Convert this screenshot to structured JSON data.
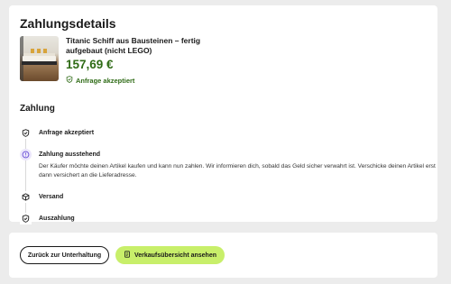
{
  "header": {
    "title": "Zahlungsdetails"
  },
  "product": {
    "title": "Titanic Schiff aus Bausteinen – fertig aufgebaut (nicht LEGO)",
    "price": "157,69 €",
    "status": "Anfrage akzeptiert",
    "status_color": "#2f6b16"
  },
  "payment": {
    "section_title": "Zahlung",
    "steps": [
      {
        "label": "Anfrage akzeptiert",
        "icon": "shield-check-icon"
      },
      {
        "label": "Zahlung ausstehend",
        "icon": "clock-icon",
        "active": true
      },
      {
        "label": "Versand",
        "icon": "box-icon"
      },
      {
        "label": "Auszahlung",
        "icon": "shield-check-icon"
      }
    ],
    "pending_description": "Der Käufer möchte deinen Artikel kaufen und kann nun zahlen. Wir informieren dich, sobald das Geld sicher verwahrt ist. Verschicke deinen Artikel erst dann versichert an die Lieferadresse."
  },
  "actions": {
    "back_label": "Zurück zur Unterhaltung",
    "overview_label": "Verkaufsübersicht ansehen",
    "overview_icon": "document-icon",
    "accent_color": "#c8ef6a"
  }
}
